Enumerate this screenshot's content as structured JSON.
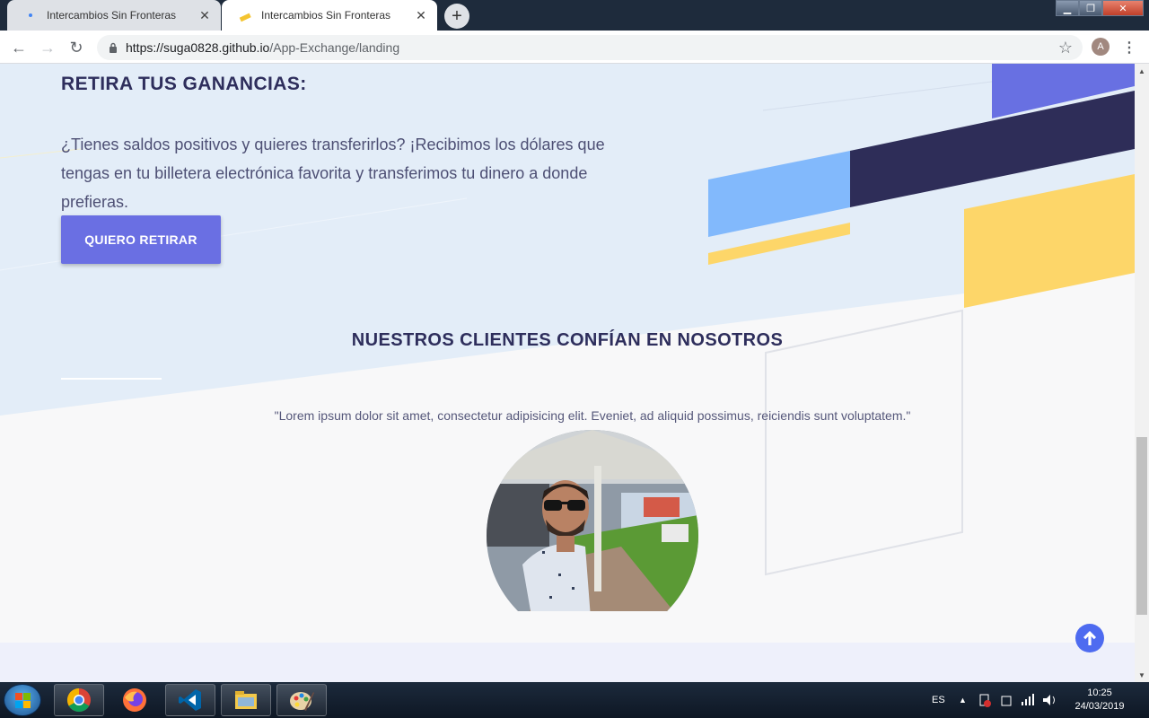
{
  "browser": {
    "tabs": [
      {
        "title": "Intercambios Sin Fronteras",
        "active": false
      },
      {
        "title": "Intercambios Sin Fronteras",
        "active": true
      }
    ],
    "url_host": "https://suga0828.github.io",
    "url_path": "/App-Exchange/landing",
    "profile_initial": "A"
  },
  "page": {
    "withdraw": {
      "heading": "RETIRA TUS GANANCIAS:",
      "text": "¿Tienes saldos positivos y quieres transferirlos? ¡Recibimos los dólares que tengas en tu billetera electrónica favorita y transferimos tu dinero a donde prefieras.",
      "button": "QUIERO RETIRAR"
    },
    "testimonials": {
      "heading": "NUESTROS CLIENTES CONFÍAN EN NOSOTROS",
      "quote": "\"Lorem ipsum dolor sit amet, consectetur adipisicing elit. Eveniet, ad aliquid possimus, reiciendis sunt voluptatem.\""
    }
  },
  "taskbar": {
    "apps": [
      "chrome-icon",
      "firefox-icon",
      "vscode-icon",
      "file-explorer-icon",
      "paint-icon"
    ],
    "language": "ES",
    "time": "10:25",
    "date": "24/03/2019"
  },
  "colors": {
    "accent": "#6a6fe3",
    "heading": "#2e2e5c",
    "hero_bg": "#e3edf8",
    "yellow": "#fdd669",
    "navy": "#2e2d58",
    "light_blue": "#82b9fc"
  }
}
